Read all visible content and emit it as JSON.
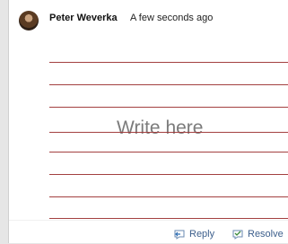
{
  "comment": {
    "author": "Peter Weverka",
    "timestamp": "A few seconds ago",
    "avatar_icon": "user-avatar",
    "placeholder": "Write here"
  },
  "actions": {
    "reply_label": "Reply",
    "resolve_label": "Resolve",
    "reply_icon": "reply-icon",
    "resolve_icon": "resolve-icon"
  },
  "colors": {
    "rule_line": "#a34040",
    "link": "#3d5f8c",
    "placeholder_text": "#7b7b7b",
    "background": "#e6e6e6"
  }
}
